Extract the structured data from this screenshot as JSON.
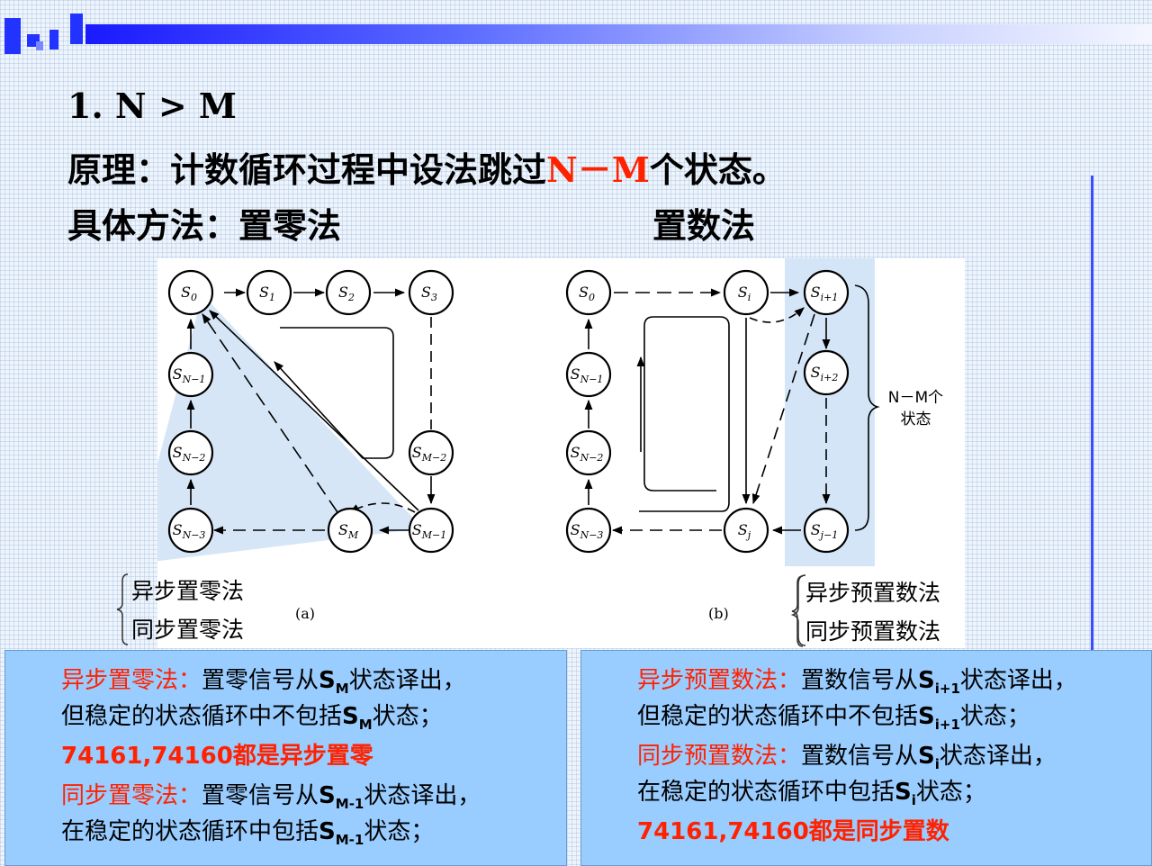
{
  "heading": {
    "line1": "1.  N > M",
    "line2_prefix": "原理：计数循环过程中设法跳过",
    "line2_highlight": "N－M",
    "line2_suffix": "个状态。",
    "line3_left": "具体方法：置零法",
    "line3_right": "置数法"
  },
  "colors": {
    "highlight": "#ff2200",
    "box_bg": "#99ccff",
    "accent": "#2233ff"
  },
  "diagram_a": {
    "caption": "(a)",
    "nodes": [
      {
        "id": "S0",
        "base": "S",
        "sub": "0"
      },
      {
        "id": "S1",
        "base": "S",
        "sub": "1"
      },
      {
        "id": "S2",
        "base": "S",
        "sub": "2"
      },
      {
        "id": "S3",
        "base": "S",
        "sub": "3"
      },
      {
        "id": "SN-1",
        "base": "S",
        "sub": "N−1"
      },
      {
        "id": "SN-2",
        "base": "S",
        "sub": "N−2"
      },
      {
        "id": "SN-3",
        "base": "S",
        "sub": "N−3"
      },
      {
        "id": "SM-2",
        "base": "S",
        "sub": "M−2"
      },
      {
        "id": "SM-1",
        "base": "S",
        "sub": "M−1"
      },
      {
        "id": "SM",
        "base": "S",
        "sub": "M"
      }
    ],
    "methods": [
      "异步置零法",
      "同步置零法"
    ]
  },
  "diagram_b": {
    "caption": "(b)",
    "nodes": [
      {
        "id": "S0",
        "base": "S",
        "sub": "0"
      },
      {
        "id": "Si",
        "base": "S",
        "sub": "i"
      },
      {
        "id": "Si+1",
        "base": "S",
        "sub": "i+1"
      },
      {
        "id": "Si+2",
        "base": "S",
        "sub": "i+2"
      },
      {
        "id": "Sj-1",
        "base": "S",
        "sub": "j−1"
      },
      {
        "id": "Sj",
        "base": "S",
        "sub": "j"
      },
      {
        "id": "SN-1",
        "base": "S",
        "sub": "N−1"
      },
      {
        "id": "SN-2",
        "base": "S",
        "sub": "N−2"
      },
      {
        "id": "SN-3",
        "base": "S",
        "sub": "N−3"
      }
    ],
    "brace_label_line1": "N－M个",
    "brace_label_line2": "状态",
    "methods": [
      "异步预置数法",
      "同步预置数法"
    ]
  },
  "left_box": {
    "p1_label": "异步置零法：",
    "p1_text_a": "置零信号从",
    "p1_sym_base": "S",
    "p1_sym_sub": "M",
    "p1_text_b": "状态译出，",
    "p2_text_a": "但稳定的状态循环中不包括",
    "p2_sym_base": "S",
    "p2_sym_sub": "M",
    "p2_text_b": "状态；",
    "p3": "74161,74160都是异步置零",
    "p4_label": "同步置零法：",
    "p4_text_a": "置零信号从",
    "p4_sym_base": "S",
    "p4_sym_sub": "M-1",
    "p4_text_b": "状态译出，",
    "p5_text_a": "在稳定的状态循环中包括",
    "p5_sym_base": "S",
    "p5_sym_sub": "M-1",
    "p5_text_b": "状态；"
  },
  "right_box": {
    "p1_label": "异步预置数法：",
    "p1_text_a": "置数信号从",
    "p1_sym_base": "S",
    "p1_sym_sub": "i+1",
    "p1_text_b": "状态译出，",
    "p2_text_a": "但稳定的状态循环中不包括",
    "p2_sym_base": "S",
    "p2_sym_sub": "i+1",
    "p2_text_b": "状态；",
    "p3_label": "同步预置数法：",
    "p3_text_a": "置数信号从",
    "p3_sym_base": "S",
    "p3_sym_sub": "i",
    "p3_text_b": "状态译出，",
    "p4_text_a": "在稳定的状态循环中包括",
    "p4_sym_base": "S",
    "p4_sym_sub": "i",
    "p4_text_b": "状态；",
    "p5": "74161,74160都是同步置数"
  }
}
